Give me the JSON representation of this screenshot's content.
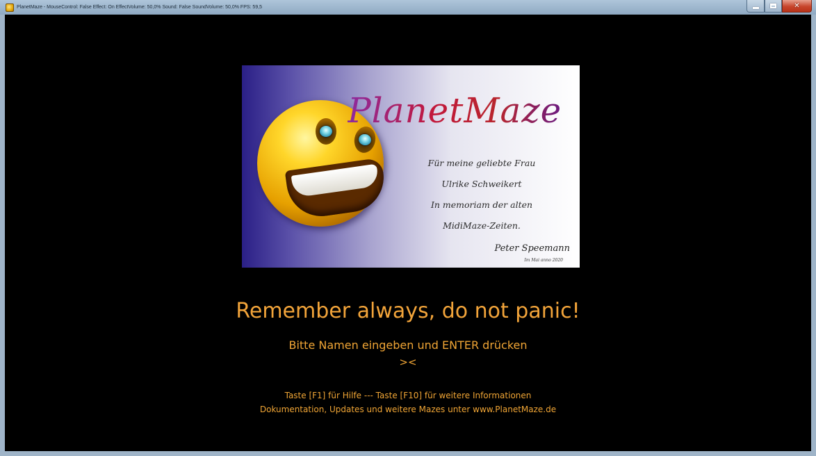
{
  "window": {
    "title": "PlanetMaze - MouseControl: False Effect: On EffectVolume: 50,0% Sound: False SoundVolume: 50,0% FPS: 59,5",
    "controls": {
      "minimize": "minimize",
      "maximize": "maximize",
      "close": "✕"
    }
  },
  "splash": {
    "logo_text": "PlanetMaze",
    "dedication": [
      "Für meine geliebte Frau",
      "Ulrike Schweikert",
      "In memoriam der alten",
      "MidiMaze-Zeiten."
    ],
    "signature": "Peter Speemann",
    "signature_date": "Im Mai anno 2020"
  },
  "screen": {
    "motto": "Remember always, do not panic!",
    "prompt": "Bitte Namen eingeben und ENTER drücken",
    "name_input": "><",
    "help_line": "Taste [F1] für Hilfe --- Taste [F10] für weitere Informationen",
    "docs_line": "Dokumentation, Updates und weitere Mazes unter www.PlanetMaze.de"
  },
  "colors": {
    "text_accent": "#f0a535",
    "background": "#000000"
  }
}
